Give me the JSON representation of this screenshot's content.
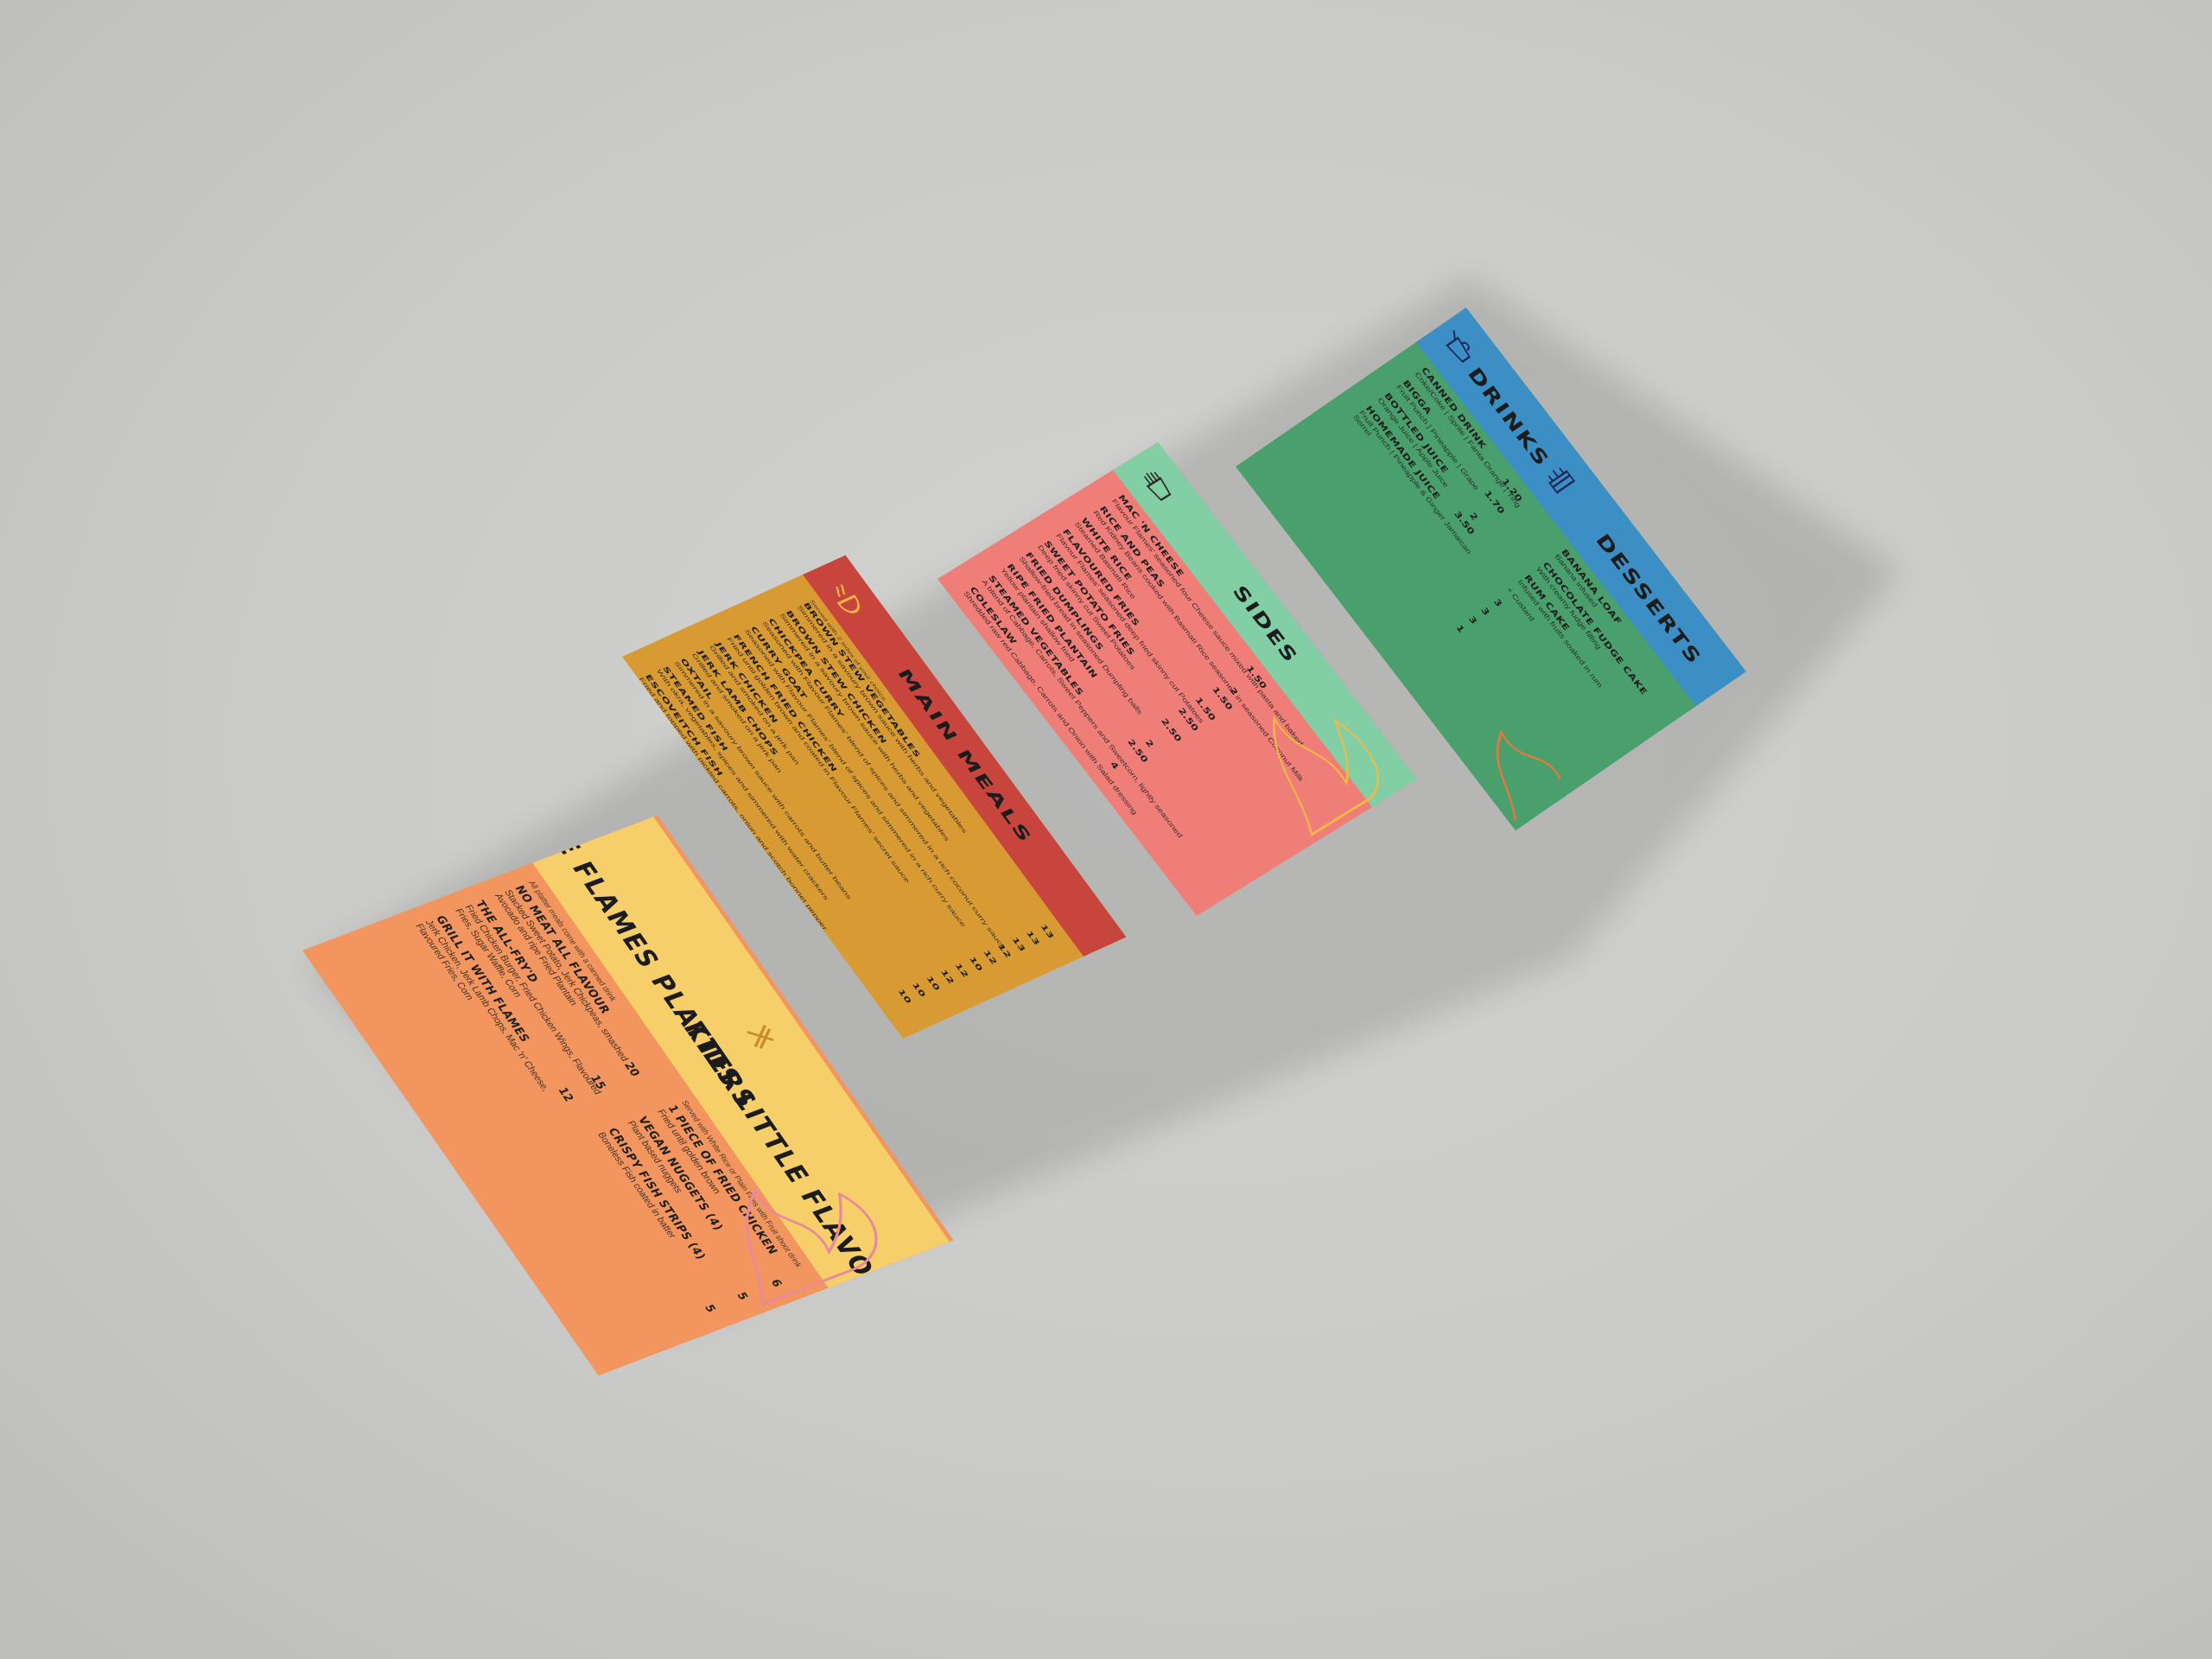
{
  "menu": {
    "platters": {
      "title": "THE FLAMES PLATTERS",
      "note": "All platter meals come with a canned drink",
      "items": [
        {
          "name": "NO MEAT ALL FLAVOUR",
          "desc": "Stacked Sweet Potato, Jerk Chickpeas, smashed Avocado and ripe Fried Plantain",
          "price": "12"
        },
        {
          "name": "THE ALL-FRY'D",
          "desc": "Fried Chicken Burger, Fried Chicken Wings, Flavoured Fries, Sugar Waffle, Corn",
          "price": "15"
        },
        {
          "name": "GRILL IT WITH FLAMES",
          "desc": "Jerk Chicken, Jerk Lamb Chops, Mac 'n' Cheese, Flavoured Fries, Corn",
          "price": "20"
        }
      ]
    },
    "kids": {
      "title": "KIDS LITTLE FLAVOUR",
      "note": "Served with White Rice or Plain Fries with Fruit shoot drink",
      "items": [
        {
          "name": "1 PIECE OF FRIED CHICKEN",
          "desc": "Fried until golden brown",
          "price": "5"
        },
        {
          "name": "VEGAN NUGGETS (4)",
          "desc": "Plant based nuggets",
          "price": "5"
        },
        {
          "name": "CRISPY FISH STRIPS (4)",
          "desc": "Boneless Fish coated in batter",
          "price": "6"
        }
      ]
    },
    "mains": {
      "title": "MAIN MEALS",
      "note": "Served with 2 sides of your choice",
      "items": [
        {
          "name": "BROWN STEW VEGETABLES",
          "desc": "Simmered in a savoury brown sauce with herbs and vegetables",
          "price": "10"
        },
        {
          "name": "BROWN STEW CHICKEN",
          "desc": "Simmered in a savoury brown sauce with herbs and vegetables",
          "price": "10"
        },
        {
          "name": "CHICKPEA CURRY",
          "desc": "Seasoned with Flavour Flames' blend of spices and simmered in a rich coconut curry sauce",
          "price": "10"
        },
        {
          "name": "CURRY GOAT",
          "desc": "Seasoned with Flavour Flames' blend of spices and simmered in a rich curry sauce",
          "price": "12"
        },
        {
          "name": "FRENCH FRIED CHICKEN",
          "desc": "Fried until golden brown and coated in Flavour Flames' secret sauce",
          "price": "12"
        },
        {
          "name": "JERK CHICKEN",
          "desc": "Grilled and smoked on a jerk pan",
          "price": "10"
        },
        {
          "name": "JERK LAMB CHOPS",
          "desc": "Grilled and smoked on a jerk pan",
          "price": "12"
        },
        {
          "name": "OXTAIL",
          "desc": "Simmered in a savoury brown sauce with carrots and butter beans",
          "price": "12"
        },
        {
          "name": "STEAMED FISH",
          "desc": "With okra, vegetables, spices and simmered with water crackers",
          "price": "13"
        },
        {
          "name": "ESCOVEITCH FISH",
          "desc": "Fried and topped with pickled carrots, onion and scotch bonnet pepper",
          "price": "13"
        },
        {
          "name": "PEPPER SHRIMP",
          "desc": "Pan-fried with secret blend of spices",
          "price": "13"
        }
      ]
    },
    "sides": {
      "title": "SIDES",
      "items": [
        {
          "name": "MAC 'N CHEESE",
          "desc": "Flavour Flames' seasoned four Cheese sauce mixed with pasta and baked",
          "price": "4"
        },
        {
          "name": "RICE AND PEAS",
          "desc": "Red Kidney Beans cooked with Basmati Rice seasoned in seasoned Coconut Milk",
          "price": "2.50"
        },
        {
          "name": "WHITE RICE",
          "desc": "Steamed Basmati Rice",
          "price": "2"
        },
        {
          "name": "FLAVOURED FRIES",
          "desc": "Flavour Flames' seasoned deep fried skinny cut Potatoes",
          "price": "2.50"
        },
        {
          "name": "SWEET POTATO FRIES",
          "desc": "Deep fried skinny cut Sweet Potatoes",
          "price": "2.50"
        },
        {
          "name": "FRIED DUMPLINGS",
          "desc": "Shallow-fried bread in seasoned Dumpling balls",
          "price": "1.50"
        },
        {
          "name": "RIPE FRIED PLANTAIN",
          "desc": "Yellow plantain shallow fried",
          "price": "1.50"
        },
        {
          "name": "STEAMED VEGETABLES",
          "desc": "A blend of Cabbage, Carrots, Sweet Peppers and Sweetcorn, lightly seasoned",
          "price": "2"
        },
        {
          "name": "COLESLAW",
          "desc": "Shredded raw red Cabbage, Carrots and Onion with Salad dressing",
          "price": "1.50"
        }
      ]
    },
    "drinks": {
      "title": "DRINKS",
      "items": [
        {
          "name": "CANNED DRINK",
          "desc": "Coke/Coke | Sprite | Fanta Orange | Ting",
          "price": "1.20"
        },
        {
          "name": "BIGGA",
          "desc": "Fruit Punch | Pineapple | Grape",
          "price": "1.70"
        },
        {
          "name": "BOTTLED JUICE",
          "desc": "Orange Juice | Apple Juice",
          "price": "2"
        },
        {
          "name": "HOMEMADE JUICE",
          "desc": "Fruit Punch | Pineapple & Ginger Jamaican Sorrel",
          "price": "3.50"
        }
      ]
    },
    "desserts": {
      "title": "DESSERTS",
      "items": [
        {
          "name": "BANANA LOAF",
          "desc": "Banana infused",
          "price": "3"
        },
        {
          "name": "CHOCOLATE FUDGE CAKE",
          "desc": "With creamy fudge filling",
          "price": "3"
        },
        {
          "name": "RUM CAKE",
          "desc": "Infused with fruits soaked in rum",
          "price": "3"
        },
        {
          "name": "+ Custard",
          "desc": "",
          "price": "1"
        }
      ]
    }
  },
  "colors": {
    "platters": "#f2955e",
    "platters_band": "#f7cf6a",
    "mains": "#d89a33",
    "mains_band": "#c8453d",
    "sides": "#ef7d78",
    "sides_band": "#82cfa6",
    "drinks": "#4aa06d",
    "drinks_band": "#3b8fc4",
    "background": "#cbcbc9"
  },
  "icons": [
    "fork-knife-icon",
    "bowl-icon",
    "fries-icon",
    "drink-icon",
    "cake-icon",
    "flame-icon"
  ]
}
